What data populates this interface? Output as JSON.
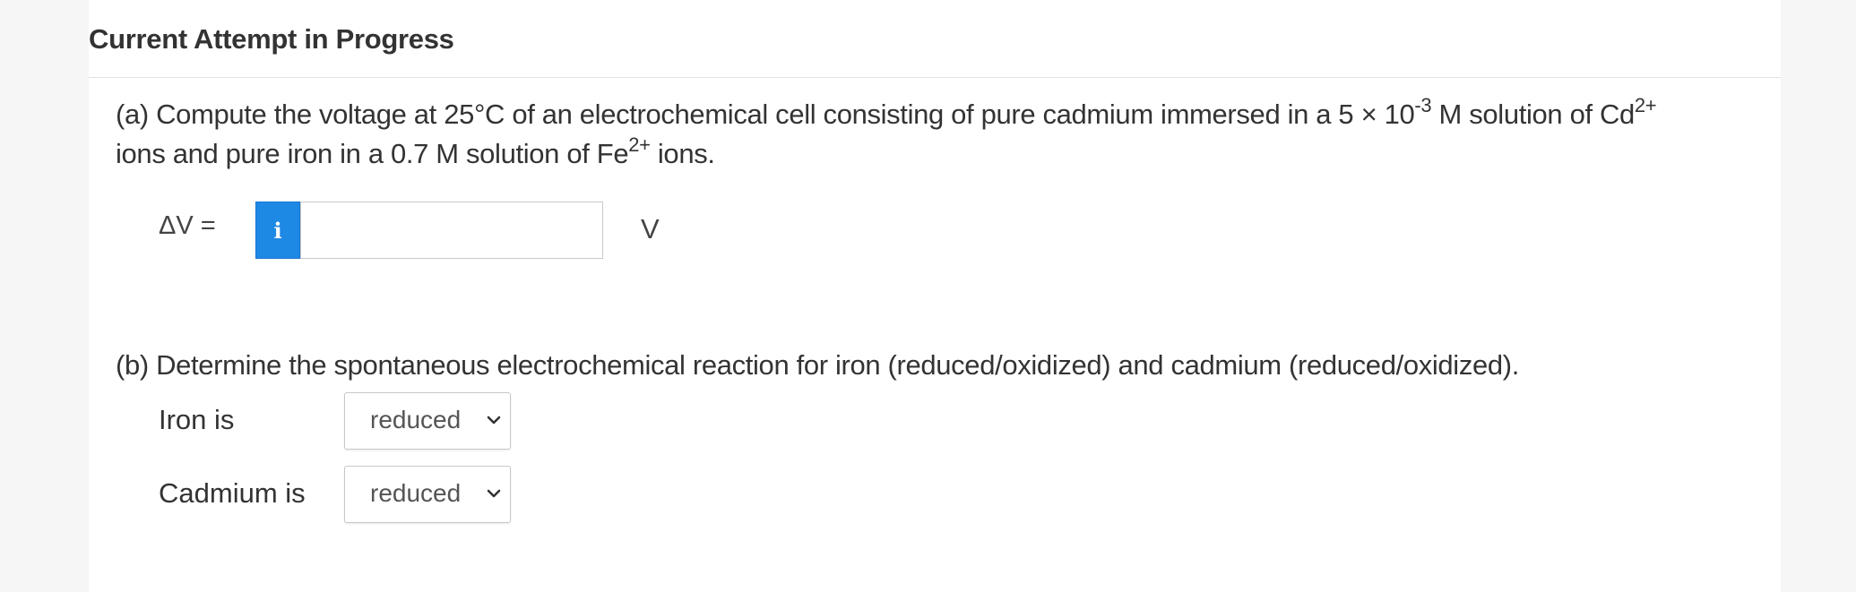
{
  "header": {
    "title": "Current Attempt in Progress"
  },
  "part_a": {
    "text_1": "(a) Compute the voltage at 25°C of an electrochemical cell consisting of pure cadmium immersed in a 5 × 10",
    "exp_1": "-3",
    "text_2": " M solution of Cd",
    "sup_2": "2+",
    "text_3": " ions and pure iron in a 0.7 M solution of Fe",
    "sup_3": "2+",
    "text_4": " ions.",
    "label": "ΔV =",
    "info_icon": "info-icon",
    "input_value": "",
    "unit": "V"
  },
  "part_b": {
    "text": "(b) Determine the spontaneous electrochemical reaction for iron (reduced/oxidized) and cadmium (reduced/oxidized).",
    "iron_label": "Iron is",
    "iron_selected": "reduced",
    "cadmium_label": "Cadmium is",
    "cadmium_selected": "reduced"
  },
  "colors": {
    "accent": "#1e88e5",
    "text": "#333333",
    "border": "#c8c8c8"
  }
}
